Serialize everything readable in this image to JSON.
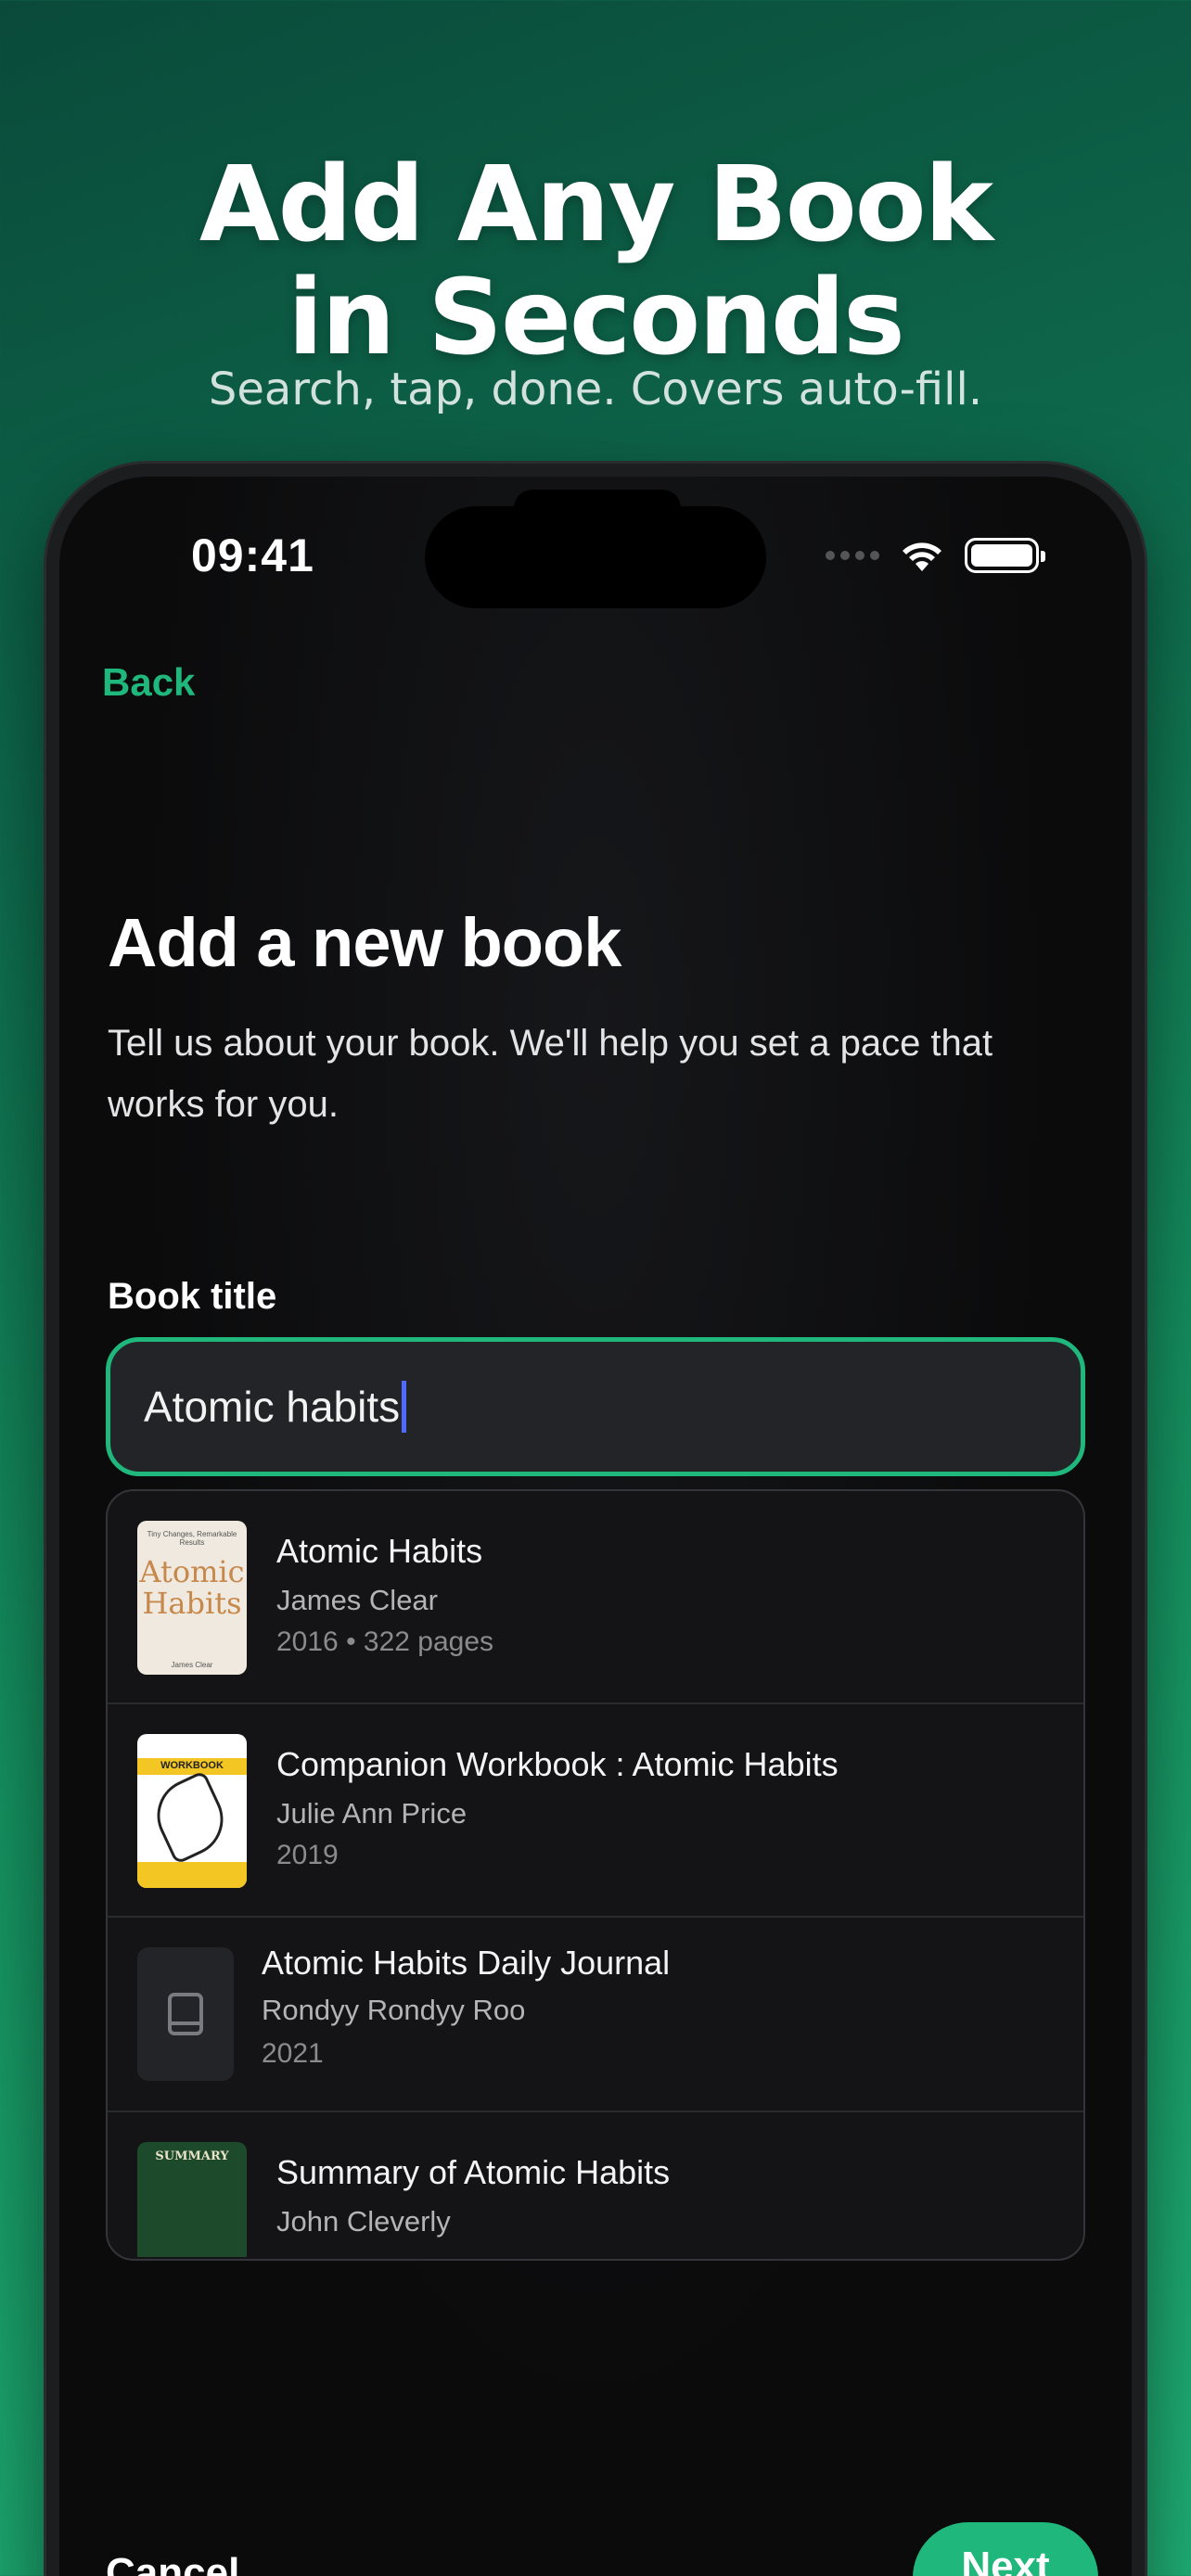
{
  "marketing": {
    "headline_line1": "Add Any Book",
    "headline_line2": "in Seconds",
    "subhead": "Search, tap, done. Covers auto-fill."
  },
  "status_bar": {
    "time": "09:41"
  },
  "nav": {
    "back_label": "Back"
  },
  "page": {
    "title": "Add a new book",
    "description": "Tell us about your book. We'll help you set a pace that works for you."
  },
  "form": {
    "book_title_label": "Book title",
    "book_title_value": "Atomic habits"
  },
  "results": [
    {
      "title": "Atomic Habits",
      "author": "James Clear",
      "meta": "2016   • 322 pages",
      "cover_text": "Atomic Habits",
      "cover_author": "James Clear"
    },
    {
      "title": "Companion Workbook : Atomic Habits",
      "author": "Julie Ann Price",
      "meta": "2019",
      "cover_text": "WORKBOOK"
    },
    {
      "title": "Atomic Habits Daily Journal",
      "author": "Rondyy Rondyy Roo",
      "meta": "2021"
    },
    {
      "title": "Summary of Atomic Habits",
      "author": "John Cleverly",
      "meta": "",
      "cover_text": "SUMMARY"
    }
  ],
  "footer": {
    "cancel_label": "Cancel",
    "next_label": "Next"
  },
  "colors": {
    "accent": "#1fb77c",
    "caret": "#4f6bff",
    "background_gradient_start": "#0a4a3a",
    "background_gradient_end": "#1fae74"
  },
  "icons": {
    "placeholder_cover": "book-icon",
    "wifi": "wifi-icon",
    "battery": "battery-icon"
  }
}
